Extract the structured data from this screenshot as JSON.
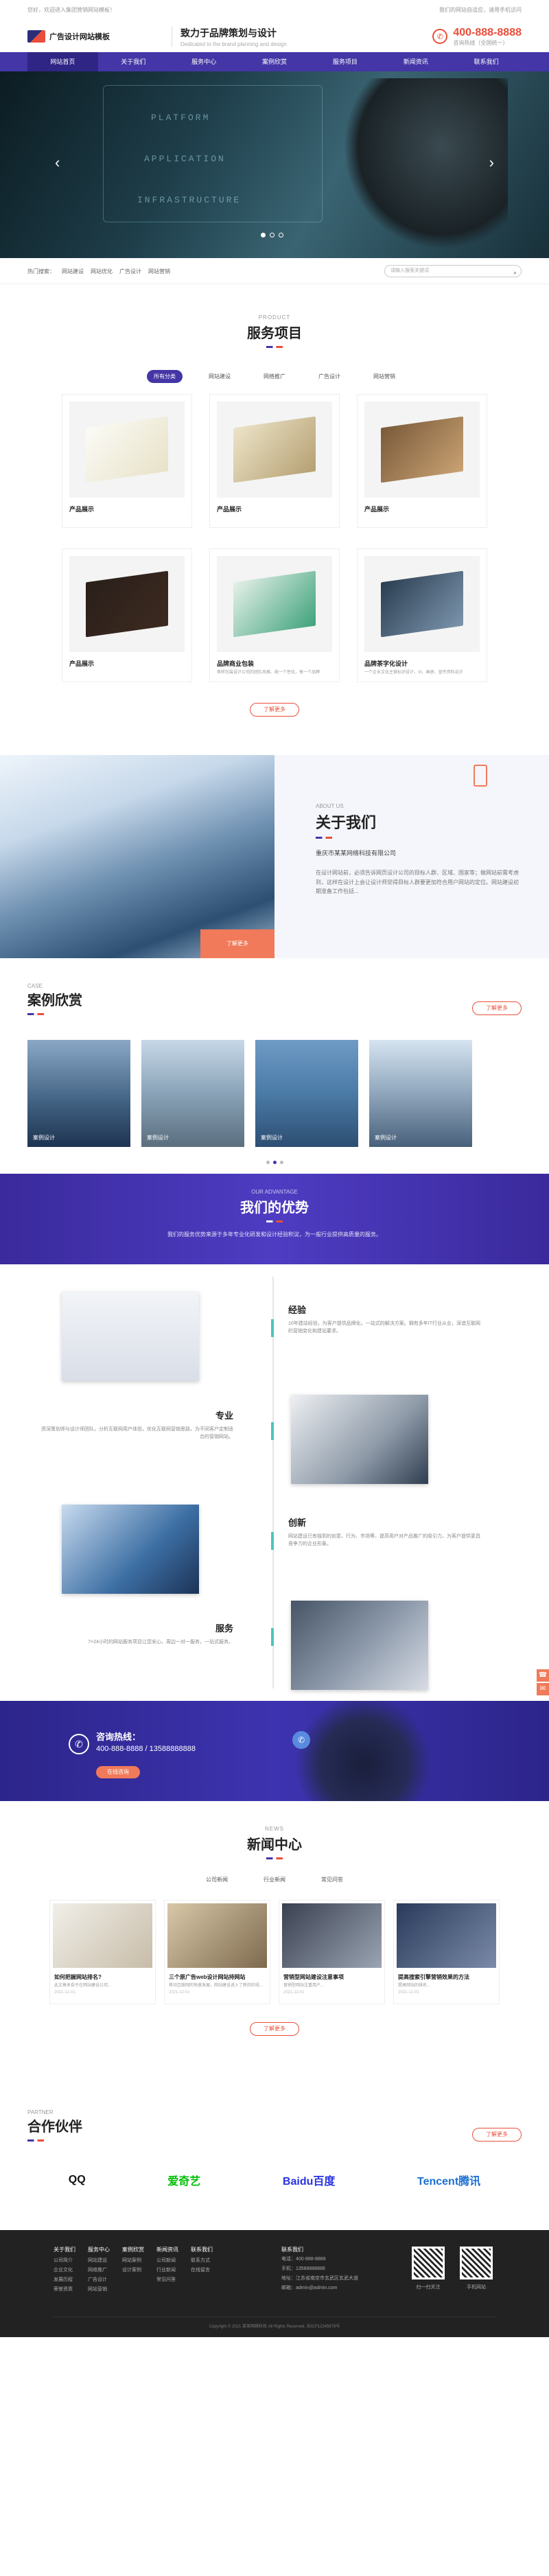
{
  "top": {
    "left": "您好，欢迎进入集团营销网站模板！",
    "right": "我们的网站自适应，请用手机访问"
  },
  "header": {
    "logo": "广告设计网站模板",
    "slogan_cn": "致力于品牌策划与设计",
    "slogan_en": "Dedicated to the brand planning and design",
    "hotline": "400-888-8888",
    "hotline_label": "咨询热线（全国统一）"
  },
  "nav": [
    "网站首页",
    "关于我们",
    "服务中心",
    "案例欣赏",
    "服务项目",
    "新闻资讯",
    "联系我们"
  ],
  "banner": {
    "words": [
      "PLATFORM",
      "APPLICATION",
      "INFRASTRUCTURE"
    ],
    "prev": "‹",
    "next": "›"
  },
  "search": {
    "keywords": [
      "热门搜索：",
      "网站建设",
      "网站优化",
      "广告设计",
      "网站营销"
    ],
    "placeholder": "请输入搜索关键词",
    "icon": "⌕"
  },
  "products": {
    "en": "PRODUCT",
    "cn": "服务项目",
    "tabs": [
      "所有分类",
      "网站建设",
      "网络推广",
      "广告设计",
      "网站营销"
    ],
    "items": [
      {
        "title": "产品展示",
        "desc": ""
      },
      {
        "title": "产品展示",
        "desc": ""
      },
      {
        "title": "产品展示",
        "desc": ""
      },
      {
        "title": "产品展示",
        "desc": ""
      },
      {
        "title": "品牌商业包装",
        "desc": "茶样包装设计公司的团队风格、统一个性化，每一个品牌"
      },
      {
        "title": "品牌茶字化设计",
        "desc": "一个企业文化主营标识设计，VI、画册、宣传资料设计"
      }
    ],
    "more": "了解更多"
  },
  "about": {
    "en": "ABOUT US",
    "cn": "关于我们",
    "company": "重庆市某某网络科技有限公司",
    "desc": "在设计网站前，必须告诉网页设计公司的目标人群、区域、国家等；做网站前需考虑到，这样在设计上会让设计师觉得目标人群要更加符合用户网站的定位。网站建设初期准备工作包括...",
    "more": "了解更多"
  },
  "cases": {
    "en": "CASE",
    "cn": "案例欣赏",
    "more": "了解更多",
    "items": [
      "案例设计",
      "案例设计",
      "案例设计",
      "案例设计"
    ]
  },
  "advantage": {
    "en": "OUR ADVANTAGE",
    "cn": "我们的优势",
    "desc": "我们的服务优势来源于多年专业化研发和设计经验积淀，为一般行业提供高质量的服务。",
    "items": [
      {
        "title": "经验",
        "desc": "10年建站经验，为客户提供品牌化，一站式的解决方案。拥有多年IT行业从业，深谙互联网的营销变化和建站要求。"
      },
      {
        "title": "专业",
        "desc": "资深策划师与设计师团队，分析互联网用户体验，优化互联网营销思路，为不同客户定制适合的营销网站。"
      },
      {
        "title": "创新",
        "desc": "网站建设已有独到的创意，行为、市场等，提高用户对产品推广的吸引力，为客户提供更具竞争力的企业形象。"
      },
      {
        "title": "服务",
        "desc": "7×24小时的网站服务项目让您安心，周边一对一服务，一站式服务。"
      }
    ]
  },
  "hotline_band": {
    "title": "咨询热线：",
    "numbers": "400-888-8888 / 13588888888",
    "btn": "在线咨询",
    "icon": "✆"
  },
  "news": {
    "en": "NEWS",
    "cn": "新闻中心",
    "tabs": [
      "公司新闻",
      "行业新闻",
      "常见问答"
    ],
    "items": [
      {
        "title": "如何把握网站排名?",
        "desc": "此文章来自于在网站建设公司...",
        "date": "2021-12-01"
      },
      {
        "title": "三个原广告web设计网站持网站",
        "desc": "移动互联网的快速发展，网站建设进入了新的阶段...",
        "date": "2021-12-01"
      },
      {
        "title": "营销型网站建设注意事项",
        "desc": "营销型网站注重用户...",
        "date": "2021-12-01"
      },
      {
        "title": "提高搜索引擎营销效果的方法",
        "desc": "提高网站的排名...",
        "date": "2021-12-01"
      }
    ],
    "more": "了解更多"
  },
  "partners": {
    "en": "PARTNER",
    "cn": "合作伙伴",
    "more": "了解更多",
    "logos": [
      "QQ",
      "爱奇艺",
      "Baidu百度",
      "Tencent腾讯"
    ]
  },
  "footer": {
    "cols": [
      {
        "h": "关于我们",
        "items": [
          "公司简介",
          "企业文化",
          "发展历程",
          "荣誉资质"
        ]
      },
      {
        "h": "服务中心",
        "items": [
          "网站建设",
          "网络推广",
          "广告设计",
          "网站营销"
        ]
      },
      {
        "h": "案例欣赏",
        "items": [
          "网站案例",
          "设计案例"
        ]
      },
      {
        "h": "新闻资讯",
        "items": [
          "公司新闻",
          "行业新闻",
          "常见问答"
        ]
      },
      {
        "h": "联系我们",
        "items": [
          "联系方式",
          "在线留言"
        ]
      }
    ],
    "contact_h": "联系我们",
    "contact": [
      "电话：400-888-8888",
      "手机：13588888888",
      "地址：江苏省南京市玄武区玄武大道",
      "邮箱：admin@admin.com"
    ],
    "qr": [
      "扫一扫关注",
      "手机网站"
    ],
    "copyright": "Copyright © 2021 某某网络科技 All Rights Reserved. 苏ICP12345678号"
  },
  "side": [
    "☎",
    "✉"
  ]
}
